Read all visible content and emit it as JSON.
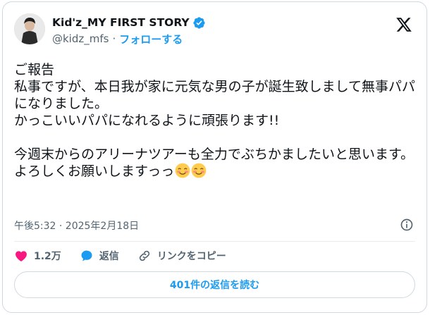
{
  "author": {
    "display_name": "Kid'z_MY FIRST STORY",
    "handle": "@kidz_mfs",
    "separator": "·",
    "follow_label": "フォローする",
    "verified": true
  },
  "tweet": {
    "text": "ご報告\n私事ですが、本日我が家に元気な男の子が誕生致しまして無事パパになりました。\nかっこいいパパになれるように頑張ります!!\n\n今週末からのアリーナツアーも全力でぶちかましたいと思います。\nよろしくお願いしますっっ",
    "emoji": [
      "smiling-face-with-smiling-eyes",
      "smiling-face-with-smiling-eyes"
    ]
  },
  "meta": {
    "timestamp": "午後5:32 · 2025年2月18日"
  },
  "actions": {
    "likes_count": "1.2万",
    "reply_label": "返信",
    "copy_link_label": "リンクをコピー"
  },
  "read_replies_label": "401件の返信を読む",
  "colors": {
    "accent": "#1d9bf0",
    "like": "#f91880",
    "text_primary": "#0f1419",
    "text_secondary": "#536471",
    "border": "#cfd9de"
  }
}
